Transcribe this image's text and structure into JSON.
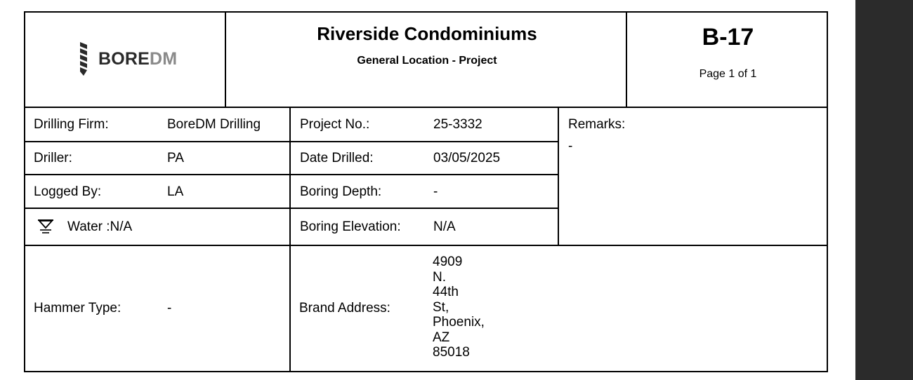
{
  "header": {
    "logo": {
      "text_a": "BORE",
      "text_b": "DM"
    },
    "title": "Riverside Condominiums",
    "subtitle": "General Location - Project",
    "boring_id": "B-17",
    "page": "Page 1 of 1"
  },
  "info": {
    "drilling_firm": {
      "label": "Drilling Firm:",
      "value": "BoreDM Drilling"
    },
    "driller": {
      "label": "Driller:",
      "value": "PA"
    },
    "logged_by": {
      "label": "Logged By:",
      "value": "LA"
    },
    "water": {
      "label": "Water :N/A"
    },
    "project_no": {
      "label": "Project No.:",
      "value": "25-3332"
    },
    "date_drilled": {
      "label": "Date Drilled:",
      "value": "03/05/2025"
    },
    "boring_depth": {
      "label": "Boring Depth:",
      "value": "-"
    },
    "boring_elevation": {
      "label": "Boring Elevation:",
      "value": "N/A"
    },
    "remarks": {
      "label": "Remarks:",
      "value": "-"
    },
    "hammer_type": {
      "label": "Hammer Type:",
      "value": "-"
    },
    "brand_address": {
      "label": "Brand Address:",
      "lines": [
        "4909",
        "N.",
        "44th",
        "St,",
        "Phoenix,",
        "AZ",
        "85018"
      ]
    }
  },
  "colors": {
    "border": "#000000",
    "logo_dark": "#2a2a2a",
    "logo_light": "#8a8a8a",
    "side_panel": "#2b2b2b"
  },
  "icons": {
    "logo_mark": "drill-bit-icon",
    "water_level": "water-level-icon"
  }
}
